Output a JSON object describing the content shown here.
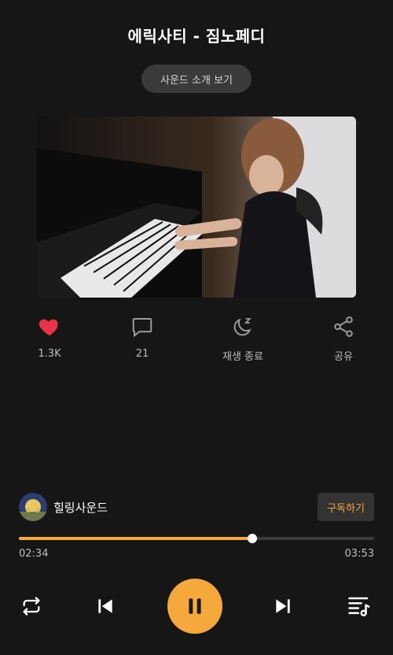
{
  "header": {
    "title": "에릭사티 - 짐노페디",
    "intro_button": "사운드 소개 보기"
  },
  "actions": {
    "like_count": "1.3K",
    "comment_count": "21",
    "sleep_label": "재생 종료",
    "share_label": "공유"
  },
  "channel": {
    "name": "힐링사운드",
    "subscribe_label": "구독하기"
  },
  "player": {
    "current_time": "02:34",
    "total_time": "03:53",
    "progress": 0.658
  },
  "colors": {
    "accent": "#f5a93c",
    "like": "#e8334a",
    "background": "#161616"
  },
  "icons": [
    "heart-icon",
    "comment-icon",
    "moon-sleep-icon",
    "share-icon",
    "repeat-icon",
    "previous-icon",
    "pause-icon",
    "next-icon",
    "playlist-icon"
  ]
}
